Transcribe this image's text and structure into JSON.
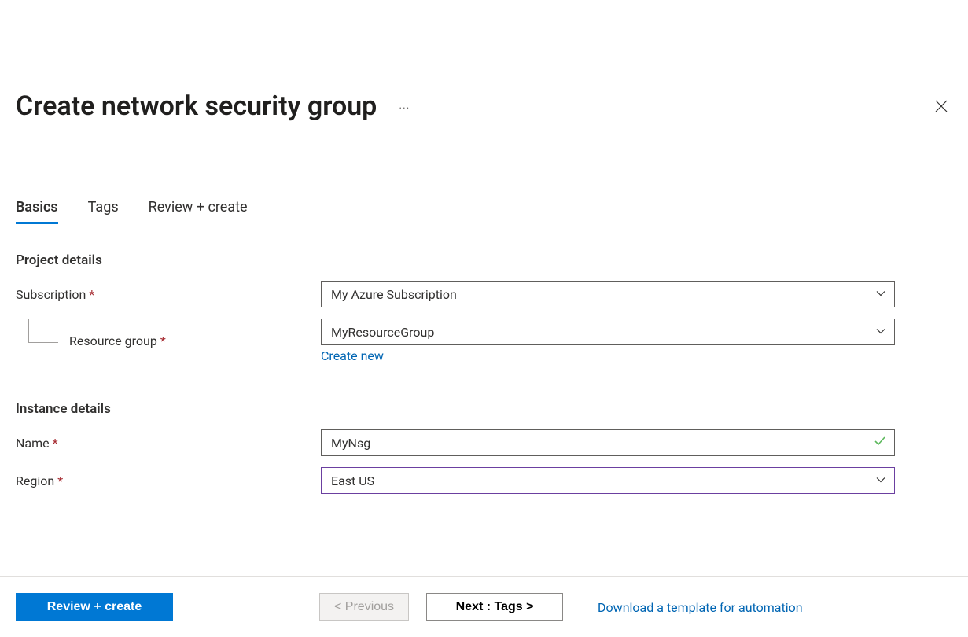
{
  "header": {
    "title": "Create network security group"
  },
  "tabs": {
    "basics": "Basics",
    "tags": "Tags",
    "review": "Review + create"
  },
  "sections": {
    "project": "Project details",
    "instance": "Instance details"
  },
  "fields": {
    "subscription_label": "Subscription",
    "subscription_value": "My Azure Subscription",
    "resource_group_label": "Resource group",
    "resource_group_value": "MyResourceGroup",
    "create_new": "Create new",
    "name_label": "Name",
    "name_value": "MyNsg",
    "region_label": "Region",
    "region_value": "East US"
  },
  "footer": {
    "review_create": "Review + create",
    "previous": "< Previous",
    "next": "Next : Tags >",
    "download_link": "Download a template for automation"
  }
}
